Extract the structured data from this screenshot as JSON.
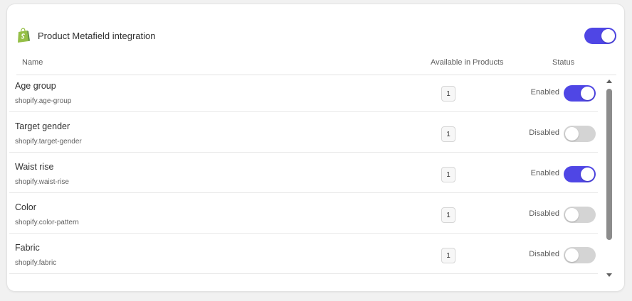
{
  "header": {
    "title": "Product Metafield integration",
    "logo_icon": "shopify-bag-icon",
    "integration_enabled": true
  },
  "table": {
    "columns": {
      "name": "Name",
      "available": "Available in Products",
      "status": "Status"
    },
    "rows": [
      {
        "name": "Age group",
        "key": "shopify.age-group",
        "count": "1",
        "status": "Enabled",
        "enabled": true
      },
      {
        "name": "Target gender",
        "key": "shopify.target-gender",
        "count": "1",
        "status": "Disabled",
        "enabled": false
      },
      {
        "name": "Waist rise",
        "key": "shopify.waist-rise",
        "count": "1",
        "status": "Enabled",
        "enabled": true
      },
      {
        "name": "Color",
        "key": "shopify.color-pattern",
        "count": "1",
        "status": "Disabled",
        "enabled": false
      },
      {
        "name": "Fabric",
        "key": "shopify.fabric",
        "count": "1",
        "status": "Disabled",
        "enabled": false
      }
    ]
  },
  "colors": {
    "accent": "#4f46e5",
    "toggle_off": "#d4d4d4",
    "shopify_green": "#95bf47"
  }
}
